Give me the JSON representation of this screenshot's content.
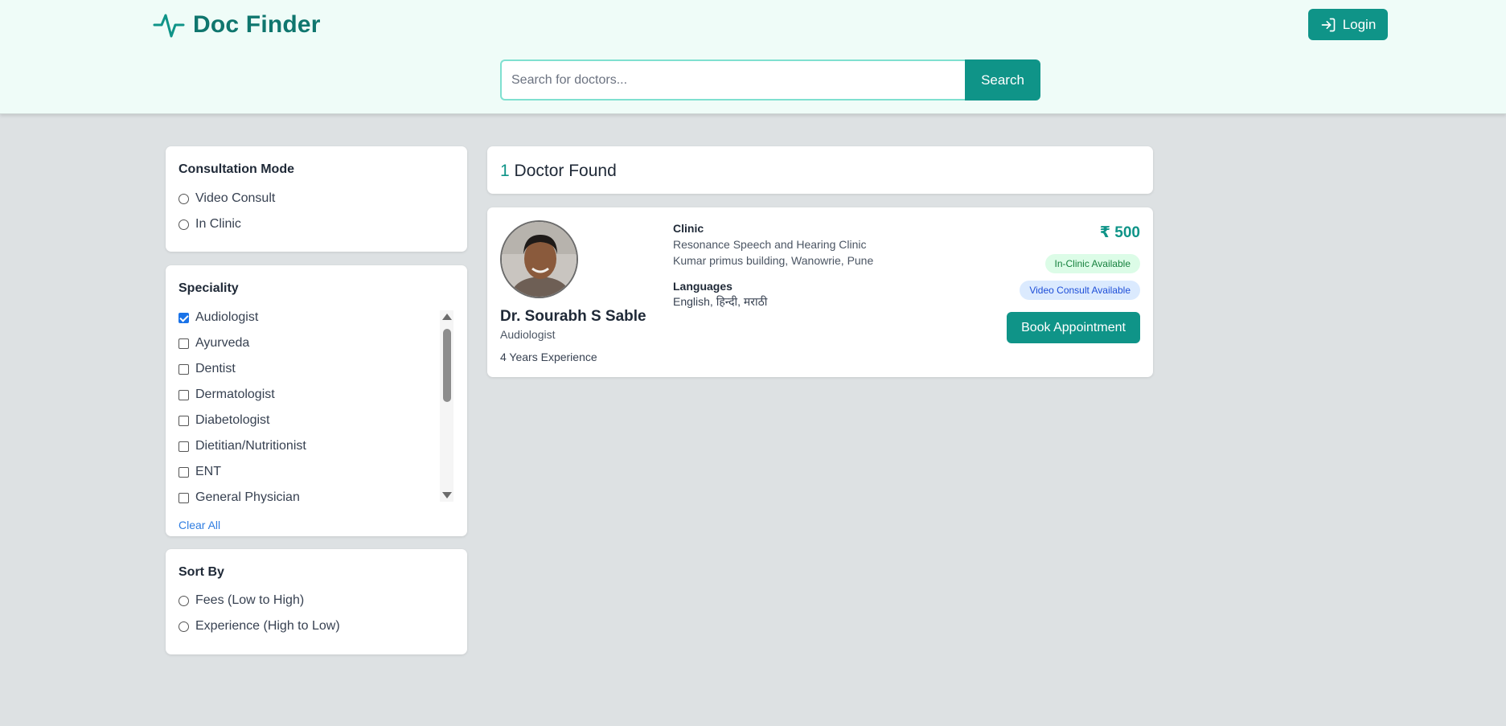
{
  "header": {
    "brand": "Doc Finder",
    "login_label": "Login",
    "search_placeholder": "Search for doctors...",
    "search_value": "",
    "search_button": "Search"
  },
  "filters": {
    "consultation": {
      "title": "Consultation Mode",
      "options": [
        "Video Consult",
        "In Clinic"
      ],
      "selected": null
    },
    "speciality": {
      "title": "Speciality",
      "options": [
        {
          "label": "Audiologist",
          "checked": true
        },
        {
          "label": "Ayurveda",
          "checked": false
        },
        {
          "label": "Dentist",
          "checked": false
        },
        {
          "label": "Dermatologist",
          "checked": false
        },
        {
          "label": "Diabetologist",
          "checked": false
        },
        {
          "label": "Dietitian/Nutritionist",
          "checked": false
        },
        {
          "label": "ENT",
          "checked": false
        },
        {
          "label": "General Physician",
          "checked": false
        }
      ],
      "clear_label": "Clear All"
    },
    "sort": {
      "title": "Sort By",
      "options": [
        "Fees (Low to High)",
        "Experience (High to Low)"
      ],
      "selected": null
    }
  },
  "results": {
    "count": "1",
    "count_label": "Doctor Found",
    "doctors": [
      {
        "name": "Dr. Sourabh S Sable",
        "speciality": "Audiologist",
        "experience": "4 Years Experience",
        "clinic_label": "Clinic",
        "clinic_name": "Resonance Speech and Hearing Clinic",
        "clinic_address": "Kumar primus building, Wanowrie, Pune",
        "languages_label": "Languages",
        "languages": "English, हिन्दी, मराठी",
        "fee": "₹ 500",
        "badge_clinic": "In-Clinic Available",
        "badge_video": "Video Consult Available",
        "book_label": "Book Appointment"
      }
    ]
  },
  "colors": {
    "primary": "#0f9488",
    "header_bg": "#effcf8",
    "page_bg": "#dde1e3",
    "link": "#2f7de1"
  }
}
